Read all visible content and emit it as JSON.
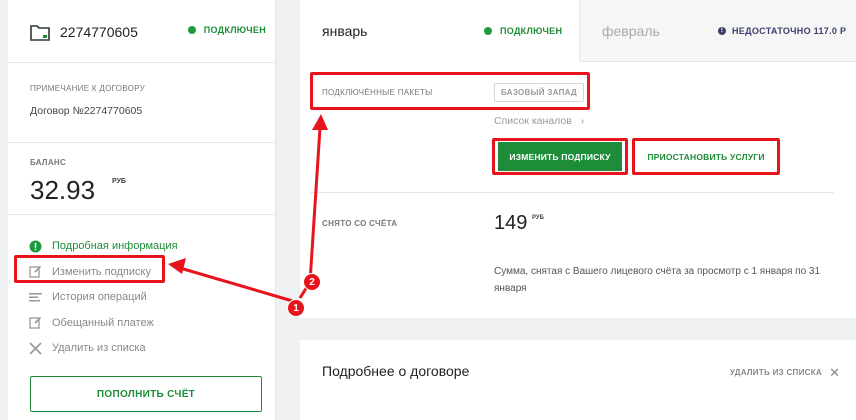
{
  "account": {
    "number": "2274770605",
    "status": "ПОДКЛЮЧЕН",
    "note_label": "ПРИМЕЧАНИЕ К ДОГОВОРУ",
    "note_value": "Договор №2274770605",
    "balance_label": "БАЛАНС",
    "balance_value": "32.93",
    "balance_unit": "РУБ"
  },
  "menu": [
    {
      "label": "Подробная информация",
      "icon": "info-icon"
    },
    {
      "label": "Изменить подписку",
      "icon": "edit-icon"
    },
    {
      "label": "История операций",
      "icon": "list-icon"
    },
    {
      "label": "Обещанный платеж",
      "icon": "edit-icon"
    },
    {
      "label": "Удалить из списка",
      "icon": "close-icon"
    }
  ],
  "topup_label": "ПОПОЛНИТЬ СЧЁТ",
  "tabs": {
    "jan": {
      "title": "январь",
      "status": "ПОДКЛЮЧЕН"
    },
    "feb": {
      "title": "февраль",
      "status": "НЕДОСТАТОЧНО 117.0 Р"
    }
  },
  "packages": {
    "label": "ПОДКЛЮЧЁННЫЕ ПАКЕТЫ",
    "tag": "БАЗОВЫЙ ЗАПАД",
    "channels_link": "Список каналов",
    "change_button": "ИЗМЕНИТЬ ПОДПИСКУ",
    "suspend_button": "ПРИОСТАНОВИТЬ УСЛУГИ"
  },
  "charged": {
    "label": "СНЯТО СО СЧЁТА",
    "value": "149",
    "unit": "РУБ",
    "description": "Сумма, снятая с Вашего лицевого счёта за просмотр с 1 января по 31 января"
  },
  "details": {
    "title": "Подробнее о договоре",
    "remove_label": "УДАЛИТЬ ИЗ СПИСКА"
  },
  "annotations": {
    "badge1": "1",
    "badge2": "2"
  },
  "colors": {
    "accent_green": "#1e8d3a",
    "highlight_red": "#e8141c",
    "warning_navy": "#3a3f6b"
  }
}
